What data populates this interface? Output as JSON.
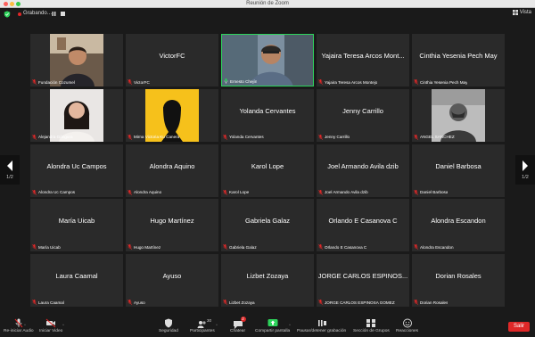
{
  "window": {
    "title": "Reunión de Zoom"
  },
  "topbar": {
    "recording_label": "Grabando…",
    "view_label": "Vista"
  },
  "colors": {
    "active_speaker": "#2dd45b",
    "leave": "#e02828",
    "tile_bg": "#2a2a2a",
    "muted_mic": "#e02828"
  },
  "pager": {
    "left_page": "1/2",
    "right_page": "1/2"
  },
  "tiles": [
    {
      "label": "Fundación Cozumel",
      "display": "",
      "video": "man-selfie",
      "active": false,
      "mic": "muted"
    },
    {
      "label": "VictorFC",
      "display": "VictorFC",
      "video": "",
      "active": false,
      "mic": "muted"
    },
    {
      "label": "Ernesto Chejín",
      "display": "",
      "video": "man-webcam",
      "active": true,
      "mic": "on"
    },
    {
      "label": "Yajaira Teresa Arcos Montejo",
      "display": "Yajaira Teresa Arcos Mont...",
      "video": "",
      "active": false,
      "mic": "muted"
    },
    {
      "label": "Cinthia Yesenia Pech May",
      "display": "Cinthia Yesenia Pech May",
      "video": "",
      "active": false,
      "mic": "muted"
    },
    {
      "label": "Alejandra Góngora",
      "display": "",
      "video": "woman-photo",
      "active": false,
      "mic": "muted"
    },
    {
      "label": "Mirna Victoria Ku Canera",
      "display": "",
      "video": "silhouette-yellow",
      "active": false,
      "mic": "muted"
    },
    {
      "label": "Yolanda Cervantes",
      "display": "Yolanda Cervantes",
      "video": "",
      "active": false,
      "mic": "muted"
    },
    {
      "label": "Jenny Carrillo",
      "display": "Jenny Carrillo",
      "video": "",
      "active": false,
      "mic": "muted"
    },
    {
      "label": "ANGEL SANCHEZ",
      "display": "",
      "video": "bw-photo",
      "active": false,
      "mic": "muted"
    },
    {
      "label": "Alondra Uc Campos",
      "display": "Alondra Uc Campos",
      "video": "",
      "active": false,
      "mic": "muted"
    },
    {
      "label": "Alondra Aquino",
      "display": "Alondra Aquino",
      "video": "",
      "active": false,
      "mic": "muted"
    },
    {
      "label": "Karol Lope",
      "display": "Karol Lope",
      "video": "",
      "active": false,
      "mic": "muted"
    },
    {
      "label": "Joel Armando Avila dzib",
      "display": "Joel Armando Avila dzib",
      "video": "",
      "active": false,
      "mic": "muted"
    },
    {
      "label": "Daniel Barbosa",
      "display": "Daniel Barbosa",
      "video": "",
      "active": false,
      "mic": "muted"
    },
    {
      "label": "María Uicab",
      "display": "María Uicab",
      "video": "",
      "active": false,
      "mic": "muted"
    },
    {
      "label": "Hugo Martínez",
      "display": "Hugo Martínez",
      "video": "",
      "active": false,
      "mic": "muted"
    },
    {
      "label": "Gabriela Galaz",
      "display": "Gabriela Galaz",
      "video": "",
      "active": false,
      "mic": "muted"
    },
    {
      "label": "Orlando E Casanova C",
      "display": "Orlando E Casanova C",
      "video": "",
      "active": false,
      "mic": "muted"
    },
    {
      "label": "Alondra Escandon",
      "display": "Alondra Escandon",
      "video": "",
      "active": false,
      "mic": "muted"
    },
    {
      "label": "Laura Caamal",
      "display": "Laura Caamal",
      "video": "",
      "active": false,
      "mic": "muted"
    },
    {
      "label": "Ayuso",
      "display": "Ayuso",
      "video": "",
      "active": false,
      "mic": "muted"
    },
    {
      "label": "Lizbet Zozaya",
      "display": "Lizbet Zozaya",
      "video": "",
      "active": false,
      "mic": "muted"
    },
    {
      "label": "JORGE CARLOS ESPINOSA GOMEZ",
      "display": "JORGE CARLOS ESPINOS...",
      "video": "",
      "active": false,
      "mic": "muted"
    },
    {
      "label": "Dorian Rosales",
      "display": "Dorian Rosales",
      "video": "",
      "active": false,
      "mic": "muted"
    }
  ],
  "toolbar": {
    "unmute": "Re-iniciar Audio",
    "start_video": "Iniciar Video",
    "security": "Seguridad",
    "participants": "Participantes",
    "participants_count": "30",
    "chat": "Chatear",
    "chat_badge": "2",
    "share": "Compartir pantalla",
    "record": "Pausar/detener grabación",
    "breakout": "Sección de Grupos",
    "reactions": "Reacciones",
    "leave": "Salir"
  }
}
